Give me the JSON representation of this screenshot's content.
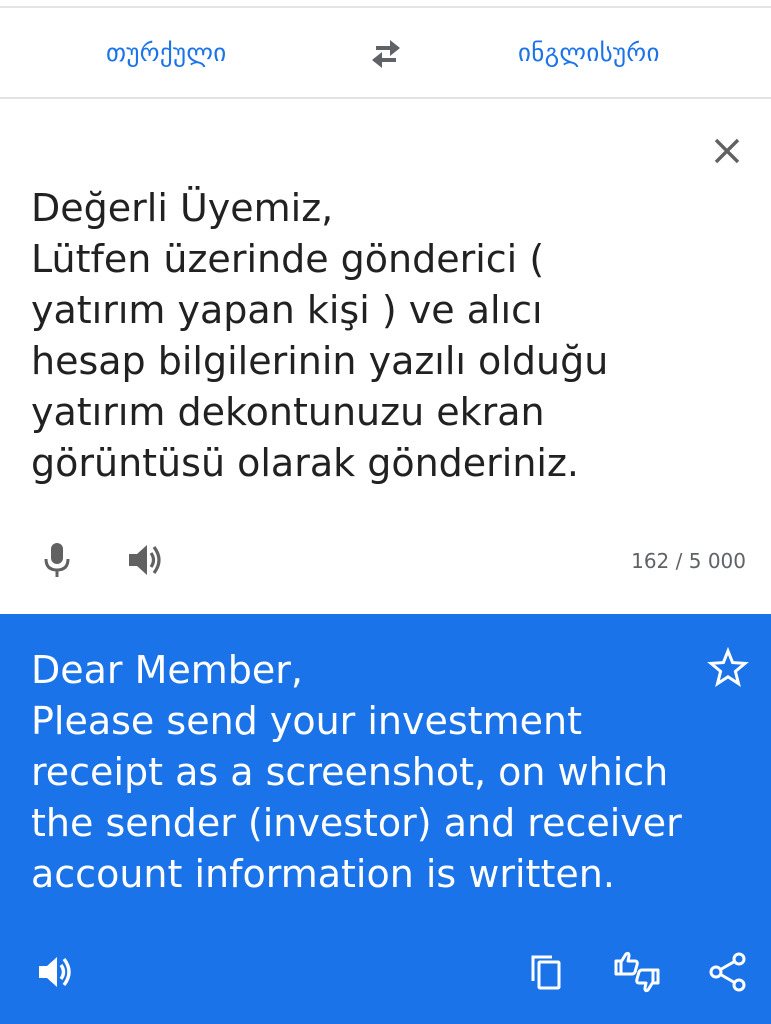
{
  "language_bar": {
    "source_language": "თურქული",
    "target_language": "ინგლისური",
    "swap_icon": "swap-arrows-icon"
  },
  "source": {
    "text": "Değerli Üyemiz,\nLütfen üzerinde gönderici (\nyatırım yapan kişi ) ve alıcı\nhesap bilgilerinin yazılı olduğu\nyatırım dekontunuzu ekran\ngörüntüsü olarak gönderiniz.",
    "char_count": "162 / 5 000",
    "icons": {
      "clear": "close-icon",
      "mic": "microphone-icon",
      "speak": "speaker-icon"
    }
  },
  "result": {
    "text": "Dear Member,\nPlease send your investment\nreceipt as a screenshot, on which\nthe sender (investor) and receiver\naccount information is written.",
    "icons": {
      "star": "star-icon",
      "speak": "speaker-icon",
      "copy": "copy-icon",
      "feedback": "feedback-thumbs-icon",
      "share": "share-icon"
    }
  },
  "colors": {
    "accent": "#1a73e8",
    "text_primary": "#212121",
    "text_secondary": "#5f6368",
    "icon_gray": "#616161",
    "result_text": "#ffffff"
  }
}
